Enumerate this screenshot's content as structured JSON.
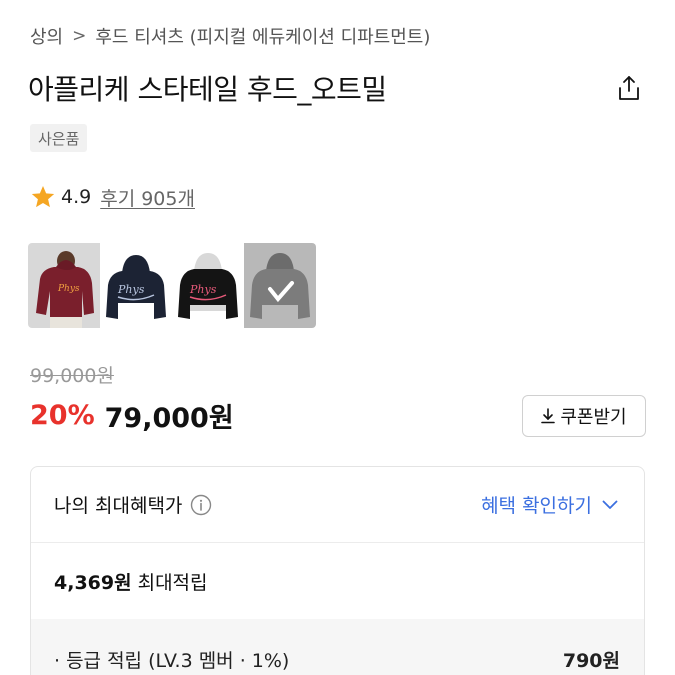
{
  "breadcrumb": {
    "items": [
      "상의",
      "후드 티셔츠 (피지컬 에듀케이션 디파트먼트)"
    ],
    "separator": ">"
  },
  "product": {
    "title": "아플리케 스타테일 후드_오트밀",
    "gift_badge": "사은품"
  },
  "rating": {
    "value": "4.9",
    "review_text": "후기 905개",
    "star_color": "#f5a623"
  },
  "thumbnails": [
    {
      "name": "burgundy-hoodie",
      "color": "#7a1f2c"
    },
    {
      "name": "navy-hoodie",
      "color": "#1c2334"
    },
    {
      "name": "black-hoodie",
      "color": "#141414"
    },
    {
      "name": "gray-hoodie",
      "color": "#7c7c7c"
    }
  ],
  "pricing": {
    "original_price": "99,000원",
    "discount_rate": "20%",
    "sale_price": "79,000원",
    "discount_color": "#e8322c",
    "coupon_button": "쿠폰받기"
  },
  "benefits": {
    "title": "나의 최대혜택가",
    "toggle_label": "혜택 확인하기",
    "toggle_color": "#3b6fe0",
    "max_points_amount": "4,369원",
    "max_points_label": "최대적립",
    "grade_label": "· 등급 적립 (LV.3 멤버 · 1%)",
    "grade_value": "790원"
  }
}
